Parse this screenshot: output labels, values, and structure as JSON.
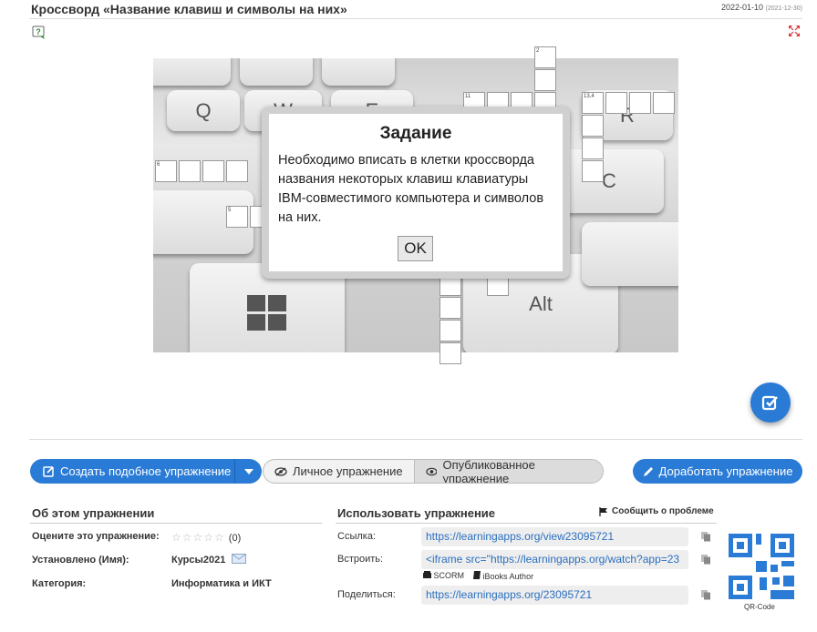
{
  "header": {
    "title": "Кроссворд «Название клавиш и символы на них»",
    "date": "2022-01-10",
    "date_secondary": "(2021-12-30)"
  },
  "board": {
    "keys": [
      "Q",
      "W",
      "E",
      "R",
      "C",
      "Alt"
    ],
    "cell_numbers": [
      "2",
      "11",
      "13,4",
      "6",
      "5"
    ]
  },
  "modal": {
    "title": "Задание",
    "text": "Необходимо вписать в клетки кроссворда названия некоторых клавиш клавиатуры IBM-совместимого компьютера и символов на них.",
    "ok_label": "OK"
  },
  "actions": {
    "create_label": "Создать подобное упражнение",
    "private_label": "Личное упражнение",
    "published_label": "Опубликованное упражнение",
    "edit_label": "Доработать упражнение"
  },
  "about": {
    "title": "Об этом упражнении",
    "rate_label": "Оцените это упражнение:",
    "rating_stars": "☆☆☆☆☆",
    "rating_count": "(0)",
    "installed_label": "Установлено (Имя):",
    "installed_value": "Курсы2021",
    "category_label": "Категория:",
    "category_value": "Информатика и ИКТ"
  },
  "use": {
    "title": "Использовать упражнение",
    "report_label": "Сообщить о проблеме",
    "link_label": "Ссылка:",
    "link_value": "https://learningapps.org/view23095721",
    "embed_label": "Встроить:",
    "embed_value": "<iframe src=\"https://learningapps.org/watch?app=23",
    "scorm_label": "SCORM",
    "ibooks_label": "iBooks Author",
    "share_label": "Поделиться:",
    "share_value": "https://learningapps.org/23095721",
    "qr_label": "QR-Code"
  },
  "colors": {
    "accent": "#2a7bd6",
    "link": "#2a6fbf"
  }
}
